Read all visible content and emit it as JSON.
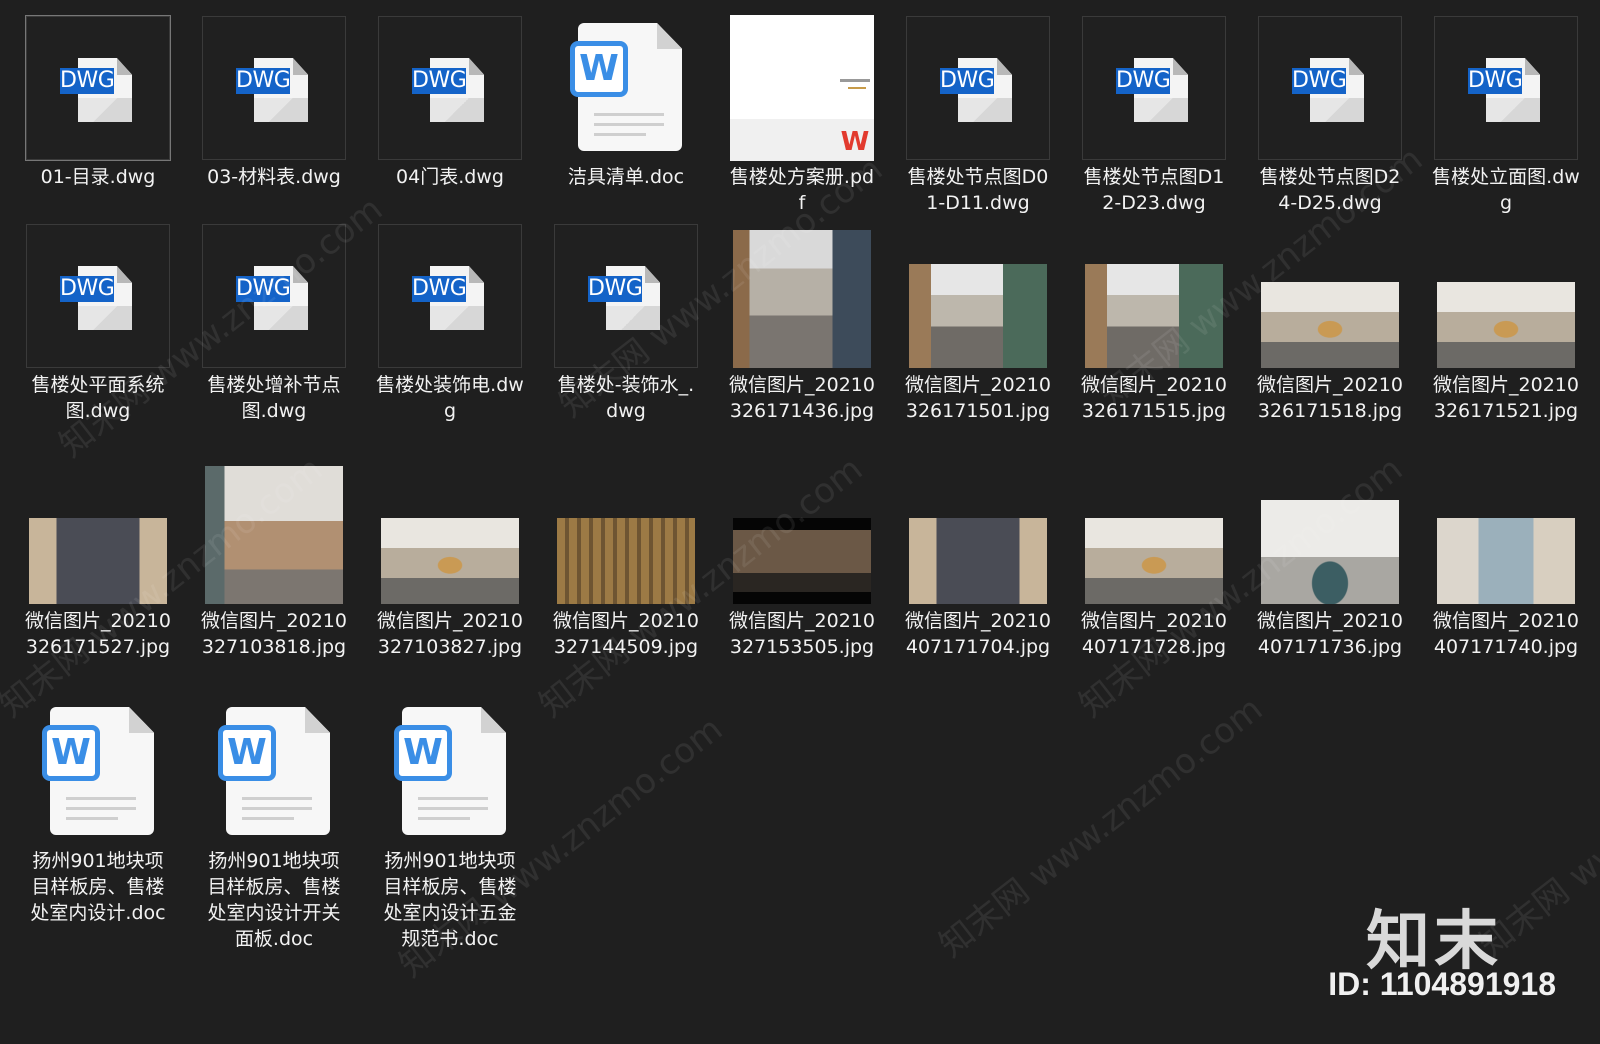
{
  "files": [
    {
      "type": "dwg",
      "name": "01-目录.dwg",
      "selected": true
    },
    {
      "type": "dwg",
      "name": "03-材料表.dwg"
    },
    {
      "type": "dwg",
      "name": "04门表.dwg"
    },
    {
      "type": "doc",
      "name": "洁具清单.doc"
    },
    {
      "type": "pdf",
      "name": "售楼处方案册.pdf"
    },
    {
      "type": "dwg",
      "name": "售楼处节点图D01-D11.dwg"
    },
    {
      "type": "dwg",
      "name": "售楼处节点图D12-D23.dwg"
    },
    {
      "type": "dwg",
      "name": "售楼处节点图D24-D25.dwg"
    },
    {
      "type": "dwg",
      "name": "售楼处立面图.dwg"
    },
    {
      "type": "dwg",
      "name": "售楼处平面系统图.dwg"
    },
    {
      "type": "dwg",
      "name": "售楼处增补节点图.dwg"
    },
    {
      "type": "dwg",
      "name": "售楼处装饰电.dwg"
    },
    {
      "type": "dwg",
      "name": "售楼处-装饰水_.dwg"
    },
    {
      "type": "jpg",
      "thumb": "p-corridor",
      "name": "微信图片_20210326171436.jpg"
    },
    {
      "type": "jpg",
      "thumb": "p-corridor2",
      "name": "微信图片_20210326171501.jpg"
    },
    {
      "type": "jpg",
      "thumb": "p-corridor2",
      "name": "微信图片_20210326171515.jpg"
    },
    {
      "type": "jpg",
      "thumb": "p-hall",
      "name": "微信图片_20210326171518.jpg"
    },
    {
      "type": "jpg",
      "thumb": "p-hall",
      "name": "微信图片_20210326171521.jpg"
    },
    {
      "type": "jpg",
      "thumb": "p-wall",
      "name": "微信图片_20210326171527.jpg"
    },
    {
      "type": "jpg",
      "thumb": "p-stair",
      "name": "微信图片_20210327103818.jpg"
    },
    {
      "type": "jpg",
      "thumb": "p-hall",
      "name": "微信图片_20210327103827.jpg"
    },
    {
      "type": "jpg",
      "thumb": "p-gold",
      "name": "微信图片_20210327144509.jpg"
    },
    {
      "type": "jpg",
      "thumb": "p-dark",
      "name": "微信图片_20210327153505.jpg"
    },
    {
      "type": "jpg",
      "thumb": "p-wall",
      "name": "微信图片_20210407171704.jpg"
    },
    {
      "type": "jpg",
      "thumb": "p-hall",
      "name": "微信图片_20210407171728.jpg"
    },
    {
      "type": "jpg",
      "thumb": "p-lounge",
      "name": "微信图片_20210407171736.jpg"
    },
    {
      "type": "jpg",
      "thumb": "p-shop",
      "name": "微信图片_20210407171740.jpg"
    },
    {
      "type": "doc",
      "name": "扬州901地块项目样板房、售楼处室内设计.doc"
    },
    {
      "type": "doc",
      "name": "扬州901地块项目样板房、售楼处室内设计开关面板.doc"
    },
    {
      "type": "doc",
      "name": "扬州901地块项目样板房、售楼处室内设计五金规范书.doc"
    }
  ],
  "labels": {
    "dwg_tag": "DWG",
    "word_letter": "W",
    "wps_mark": "W"
  },
  "watermark": {
    "text": "知末网 www.znzmo.com"
  },
  "brand": {
    "name": "知末",
    "id_text": "ID: 1104891918"
  }
}
